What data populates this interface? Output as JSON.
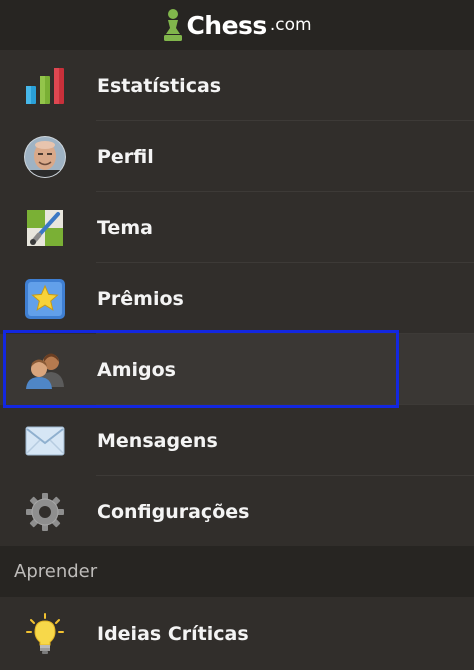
{
  "header": {
    "logo_text": "Chess",
    "logo_suffix": ".com"
  },
  "menu": {
    "items": [
      {
        "label": "Estatísticas",
        "icon": "bar-chart-icon"
      },
      {
        "label": "Perfil",
        "icon": "avatar"
      },
      {
        "label": "Tema",
        "icon": "paint-brush-icon"
      },
      {
        "label": "Prêmios",
        "icon": "star-icon"
      },
      {
        "label": "Amigos",
        "icon": "friends-icon",
        "selected": true
      },
      {
        "label": "Mensagens",
        "icon": "envelope-icon"
      },
      {
        "label": "Configurações",
        "icon": "gear-icon"
      }
    ]
  },
  "section": {
    "label": "Aprender"
  },
  "learn": {
    "items": [
      {
        "label": "Ideias Críticas",
        "icon": "lightbulb-icon"
      }
    ]
  },
  "colors": {
    "background": "#312e2b",
    "header_bg": "#272522",
    "selection": "#1327e0",
    "logo_green": "#81b64c"
  }
}
